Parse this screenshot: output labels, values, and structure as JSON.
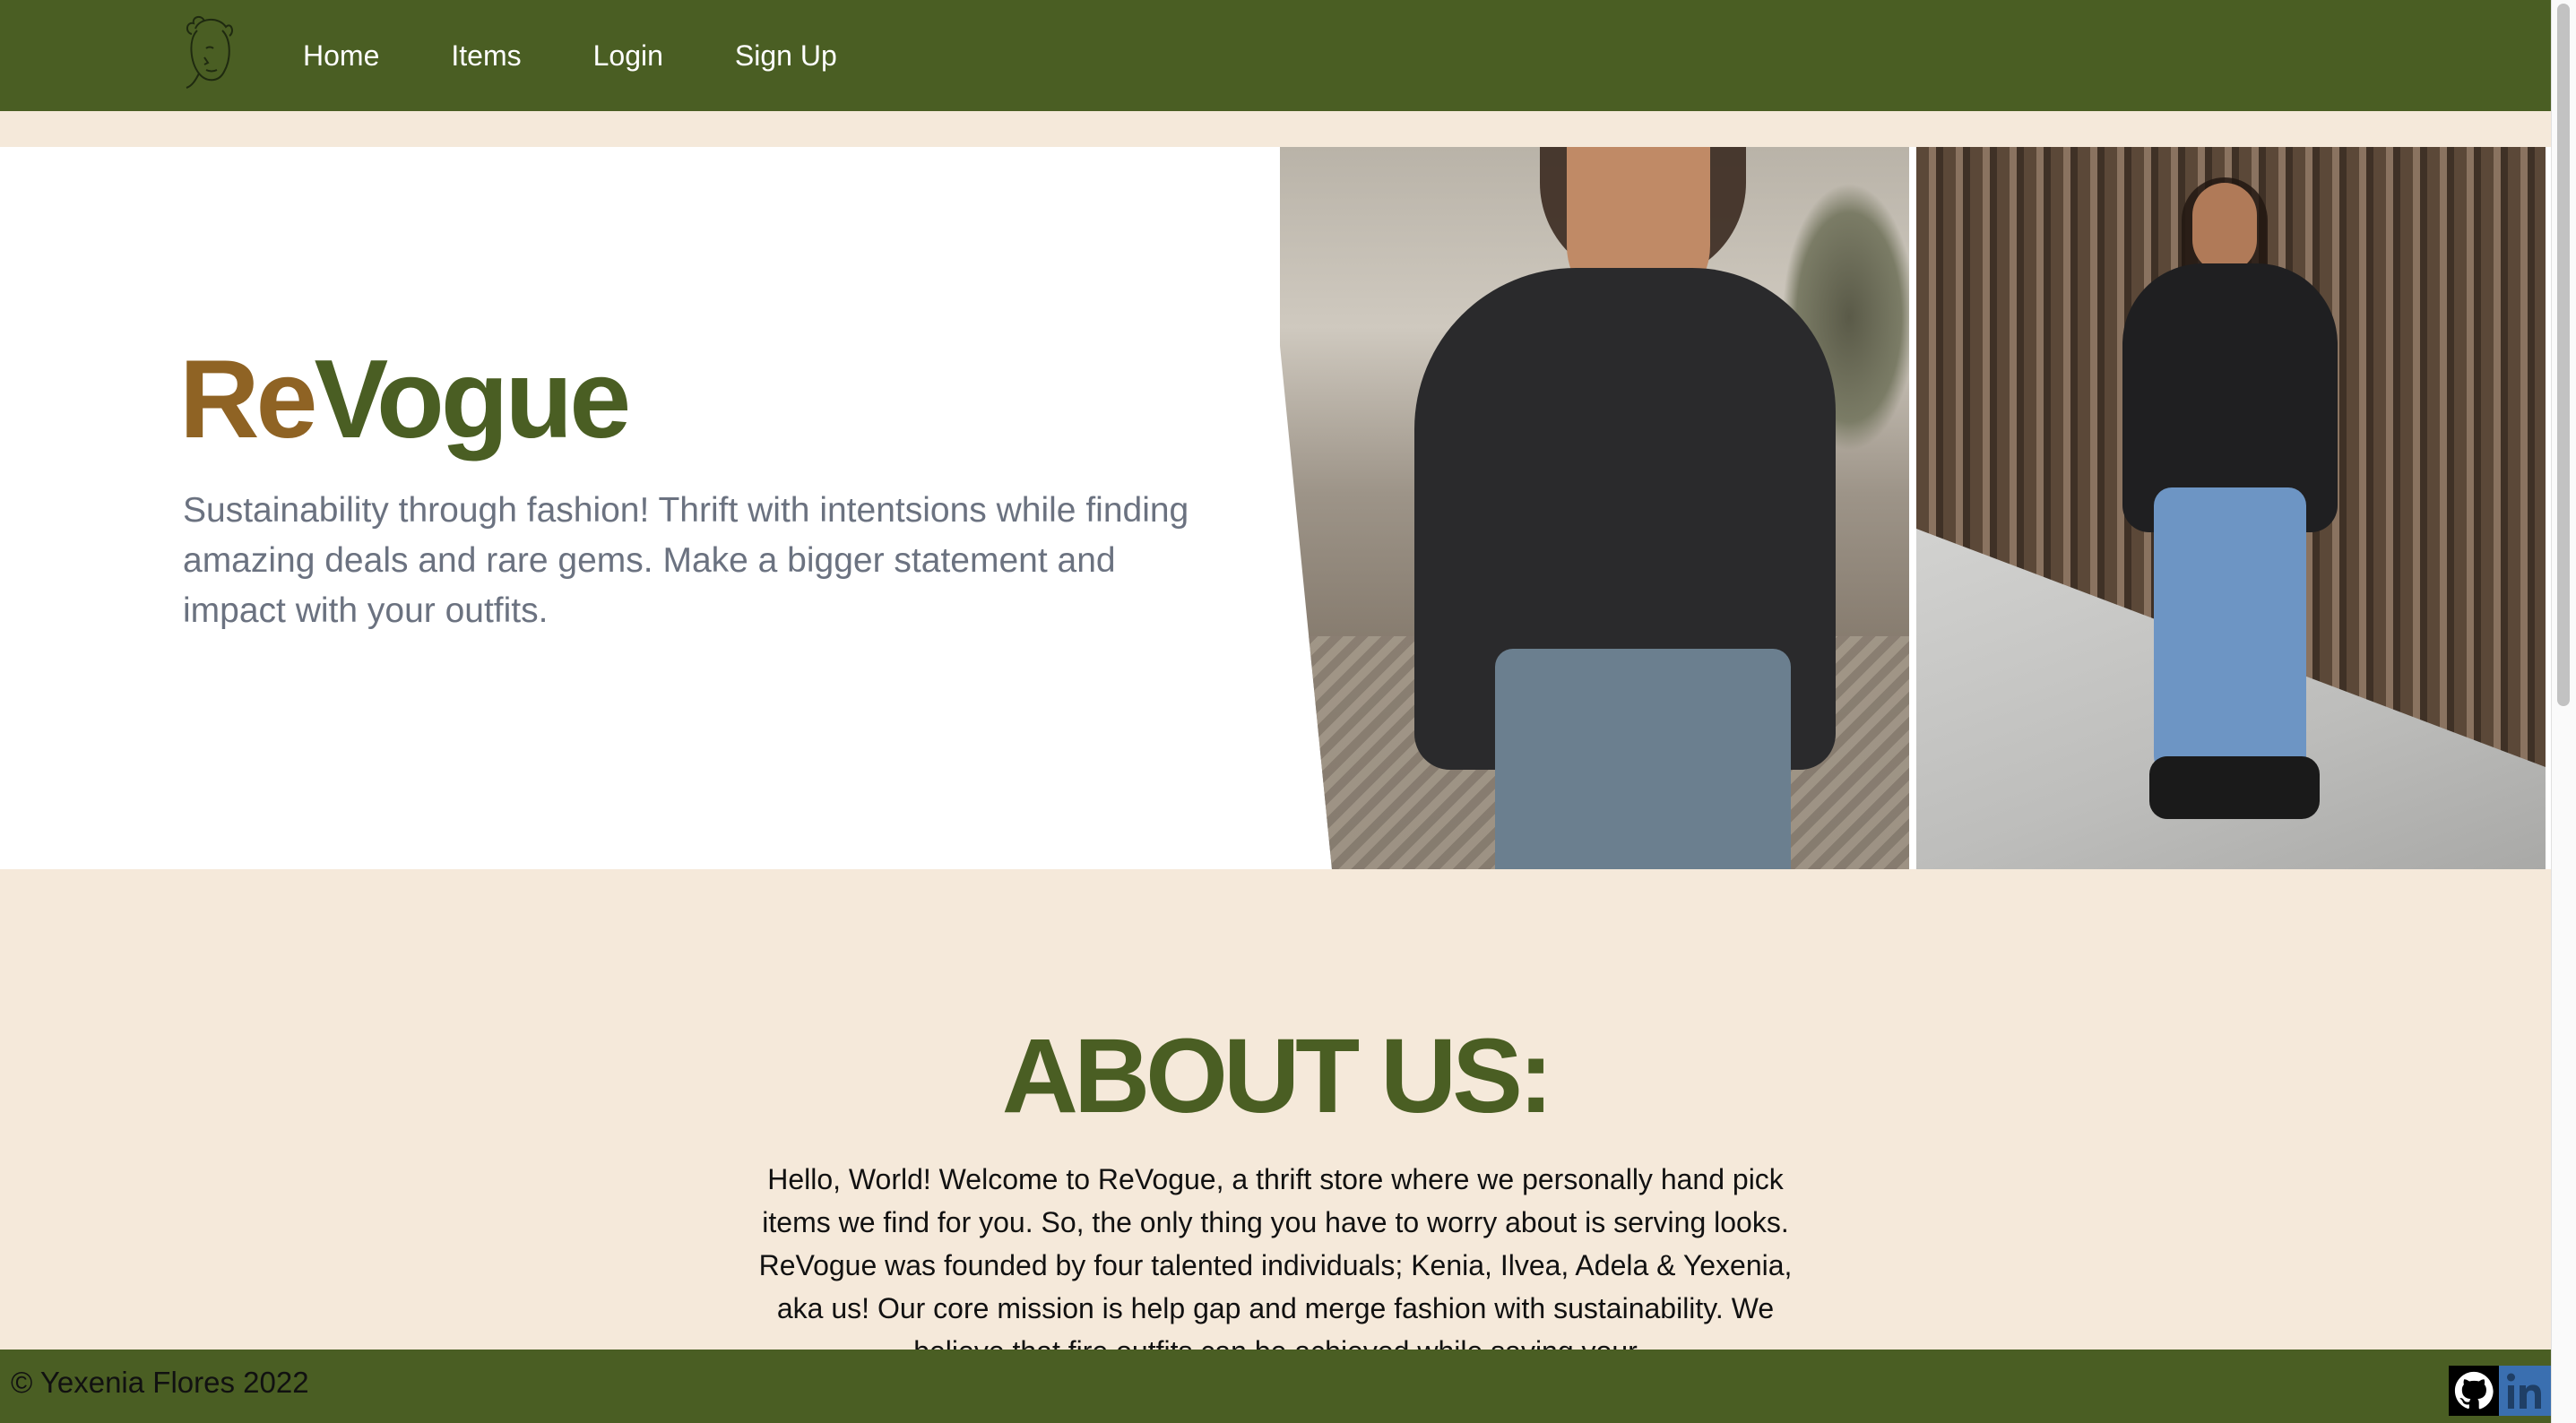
{
  "nav": {
    "logo_icon": "line-art-face-logo-icon",
    "links": [
      {
        "label": "Home"
      },
      {
        "label": "Items"
      },
      {
        "label": "Login"
      },
      {
        "label": "Sign Up"
      }
    ]
  },
  "hero": {
    "title_re": "Re",
    "title_vogue": "Vogue",
    "subtitle": "Sustainability through fashion! Thrift with intentsions while finding amazing deals and rare gems. Make a bigger statement and impact with your outfits."
  },
  "about": {
    "heading": "ABOUT US:",
    "body": "Hello, World! Welcome to ReVogue, a thrift store where we personally hand pick items we find for you. So, the only thing you have to worry about is serving looks. ReVogue was founded by four talented individuals; Kenia, Ilvea, Adela & Yexenia, aka us! Our core mission is help gap and merge fashion with sustainability. We believe that fire outfits can be achieved while saving your"
  },
  "footer": {
    "copyright": "© Yexenia Flores 2022",
    "social_icons": [
      "github-icon",
      "linkedin-icon"
    ]
  },
  "colors": {
    "brand_green": "#4a5e23",
    "brand_brown": "#8f6324",
    "background_cream": "#f5e9da",
    "text_gray": "#6b7280"
  }
}
